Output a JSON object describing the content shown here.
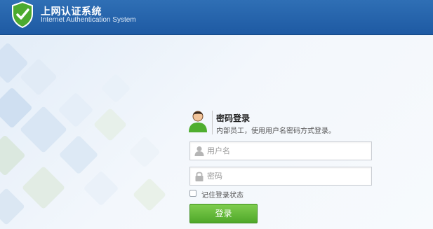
{
  "header": {
    "title_cn": "上网认证系统",
    "title_en": "Internet Authentication System",
    "logo_icon": "shield-check-icon"
  },
  "login": {
    "title": "密码登录",
    "description": "内部员工，使用用户名密码方式登录。",
    "avatar_icon": "user-avatar-icon",
    "username": {
      "placeholder": "用户名",
      "value": "",
      "icon": "user-icon"
    },
    "password": {
      "placeholder": "密码",
      "value": "",
      "icon": "lock-icon"
    },
    "remember_label": "记住登录状态",
    "remember_checked": false,
    "submit_label": "登录"
  },
  "colors": {
    "header": "#2f6fb5",
    "button": "#5cb532",
    "shield": "#4caa2f"
  }
}
